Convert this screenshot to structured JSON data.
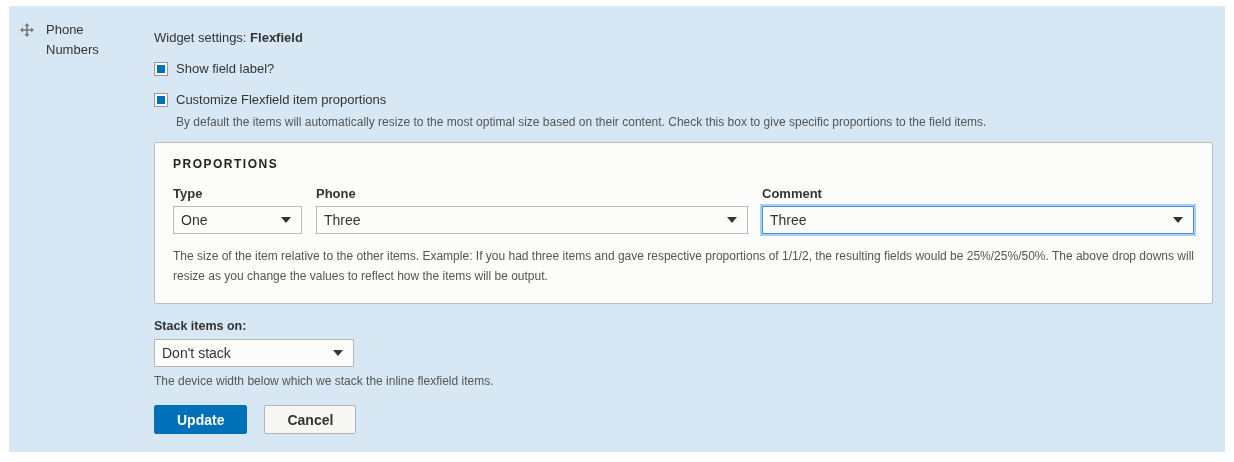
{
  "row": {
    "label": "Phone Numbers"
  },
  "widget_title": "Widget settings: **Flexfield**",
  "checkboxes": [
    {
      "label": "Show field label?",
      "checked": true
    },
    {
      "label": "Customize Flexfield item proportions",
      "checked": true,
      "description": "By default the items will automatically resize to the most optimal size based on their content. Check this box to give specific proportions to the field items."
    }
  ],
  "proportions": {
    "heading": "PROPORTIONS",
    "selects": [
      {
        "label": "Type",
        "value": "One",
        "focused": false
      },
      {
        "label": "Phone",
        "value": "Three",
        "focused": false
      },
      {
        "label": "Comment",
        "value": "Three",
        "focused": true
      }
    ],
    "help": "The size of the item relative to the other items. Example: If you had three items and gave respective proportions of 1/1/2, the resulting fields would be 25%/25%/50%. The above drop downs will resize as you change the values to reflect how the items will be output."
  },
  "stack": {
    "label": "Stack items on:",
    "value": "Don't stack",
    "description": "The device width below which we stack the inline flexfield items."
  },
  "buttons": [
    {
      "label": "Update",
      "kind": "primary"
    },
    {
      "label": "Cancel",
      "kind": "secondary"
    }
  ]
}
